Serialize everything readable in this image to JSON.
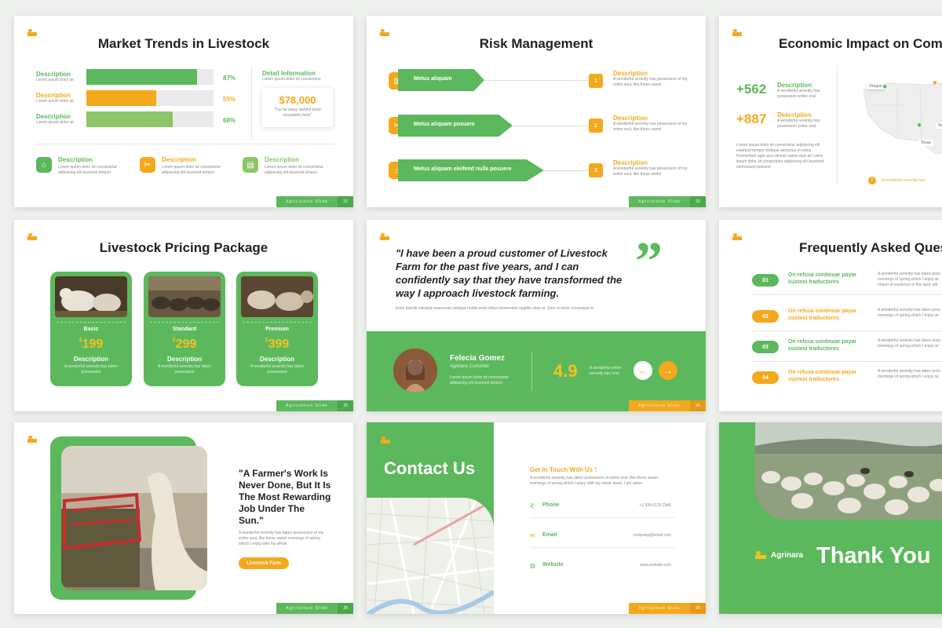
{
  "colors": {
    "green": "#5cb85c",
    "orange": "#f4a81c",
    "dark": "#222222"
  },
  "footer_label": "Agriculture Slide",
  "s1": {
    "title": "Market Trends in Livestock",
    "bars": [
      {
        "label": "Description",
        "sub": "Lorem ipsum dolor sit",
        "percent": 87,
        "pct_text": "87%",
        "color": "#5cb85c"
      },
      {
        "label": "Description",
        "sub": "Lorem ipsum dolor sit",
        "percent": 55,
        "pct_text": "55%",
        "color": "#f4a81c"
      },
      {
        "label": "Description",
        "sub": "Lorem ipsum dolor sit",
        "percent": 68,
        "pct_text": "68%",
        "color": "#8cc468"
      }
    ],
    "detail_title": "Detail Information",
    "detail_sub": "Lorem ipsum dolor sit consectetur",
    "amount": "$78,000",
    "amount_caption": "\"Far far away, behind word mountains from\"",
    "items": [
      {
        "label": "Description",
        "text": "Lorem ipsum dolor sit consectetur adipiscing elit eiusmod tempor"
      },
      {
        "label": "Description",
        "text": "Lorem ipsum dolor sit consectetur adipiscing elit eiusmod tempor"
      },
      {
        "label": "Description",
        "text": "Lorem ipsum dolor sit consectetur adipiscing elit eiusmod tempor"
      }
    ],
    "page": "22"
  },
  "s2": {
    "title": "Risk Management",
    "arrows": [
      {
        "label": "Metus aliquam",
        "num": "1"
      },
      {
        "label": "Metus aliquam posuere",
        "num": "2"
      },
      {
        "label": "Metus aliquam eleifend nulla posuere",
        "num": "3"
      }
    ],
    "desc_label": "Description",
    "desc_text": "A wonderful serenity has possession of my entire soul, like these sweet",
    "page": "23"
  },
  "s3": {
    "title": "Economic Impact on Com",
    "stats": [
      {
        "value": "+562",
        "label": "Description",
        "text": "A wonderful serenity has possession entire soul"
      },
      {
        "value": "+887",
        "label": "Description",
        "text": "A wonderful serenity has possession entire soul"
      }
    ],
    "para": "Lorem ipsum dolor sit consectetur adipiscing elit eiusmod tempor tristique senectus et netus Fermentum eget arcu dictum varius duis at Lorem ipsum dolor sit consectetur adipiscing elit eiusmod elementum possere",
    "map_labels": [
      "Oregon",
      "New S",
      "Texas"
    ],
    "note": "\"A wonderful serenity has"
  },
  "s4": {
    "title": "Livestock Pricing Package",
    "cards": [
      {
        "tier": "Basic",
        "price": "199",
        "desc": "Description",
        "text": "A wonderful serenity has taken possession"
      },
      {
        "tier": "Standard",
        "price": "299",
        "desc": "Description",
        "text": "A wonderful serenity has taken possession"
      },
      {
        "tier": "Premium",
        "price": "399",
        "desc": "Description",
        "text": "A wonderful serenity has taken possession"
      }
    ],
    "currency": "$",
    "page": "25"
  },
  "s5": {
    "quote": "\"I have been a proud customer of Livestock Farm for the past five years, and I can confidently say that they have transformed the way I approach livestock farming.",
    "quote_sub": "Enim blandit volutpat maecenas volutpat mattis enim tellus elementum sagittis vitae et. Sem et tortor consequat id",
    "name": "Felecia Gomez",
    "role": "Agrinara Customer",
    "person_text": "Lorem ipsum dolor sit consectetur adipiscing elit eiusmod tempor",
    "rating": "4.9",
    "rating_text": "A wonderful entire serenity has soul",
    "page": "26"
  },
  "s6": {
    "title": "Frequently Asked Ques",
    "rows": [
      {
        "num": "01",
        "q": "On refusa continuar payar custosi traductores",
        "a": "A wonderful serenity has taken poss mornings of spring which I enjoy wi charm of existence in this spot, wh",
        "color": "#5cb85c"
      },
      {
        "num": "02",
        "q": "On refusa continuar payar custosi traductores",
        "a": "A wonderful serenity has taken poss mornings of spring which I enjoy wi",
        "color": "#f4a81c"
      },
      {
        "num": "03",
        "q": "On refusa continuar payar custosi traductores",
        "a": "A wonderful serenity has taken poss mornings of spring which I enjoy wi",
        "color": "#5cb85c"
      },
      {
        "num": "04",
        "q": "On refusa continuar payar custosi traductores",
        "a": "A wonderful serenity has taken poss mornings of spring which I enjoy wi",
        "color": "#f4a81c"
      }
    ]
  },
  "s7": {
    "quote": "\"A Farmer's Work Is Never Done, But It Is The Most Rewarding Job Under The Sun.\"",
    "text": "A wonderful serenity has taken possession of my entire soul, like these sweet mornings of spring which I enjoy with my whole",
    "button": "Livestock Farm",
    "page": "28"
  },
  "s8": {
    "title": "Contact Us",
    "subtitle": "Get In Touch With Us !",
    "intro": "A wonderful serenity has taken possession of entire soul, like these sweet mornings of spring which I enjoy with my whole heart. I am alone",
    "rows": [
      {
        "label": "Phone",
        "value": "+1 524 0125 2345"
      },
      {
        "label": "Email",
        "value": "company@email.com"
      },
      {
        "label": "Website",
        "value": "www.website.com"
      }
    ],
    "page": "29"
  },
  "s9": {
    "brand": "Agrinara",
    "thanks": "Thank You"
  }
}
